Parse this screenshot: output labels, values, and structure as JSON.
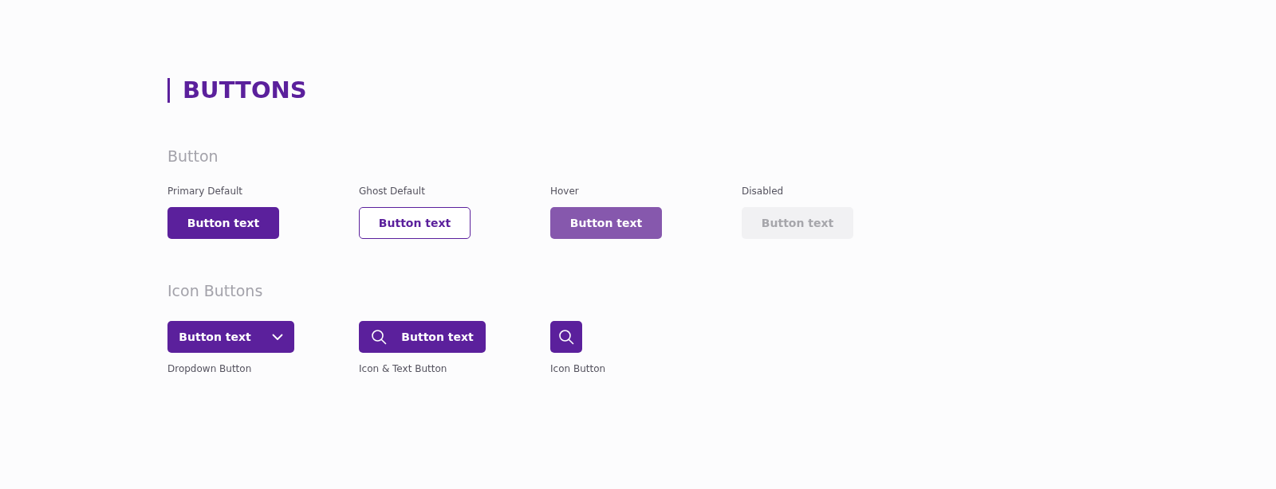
{
  "title": "BUTTONS",
  "sections": [
    {
      "heading": "Button",
      "variants": [
        {
          "label": "Primary Default",
          "kind": "primary",
          "text": "Button text",
          "disabled": false
        },
        {
          "label": "Ghost Default",
          "kind": "ghost",
          "text": "Button text",
          "disabled": false
        },
        {
          "label": "Hover",
          "kind": "hover",
          "text": "Button text",
          "disabled": false
        },
        {
          "label": "Disabled",
          "kind": "primary",
          "text": "Button text",
          "disabled": true
        }
      ]
    },
    {
      "heading": "Icon Buttons",
      "variants": [
        {
          "label": "Dropdown Button",
          "kind": "dropdown",
          "text": "Button text",
          "disabled": false
        },
        {
          "label": "Icon & Text Button",
          "kind": "icon_text",
          "text": "Button text",
          "disabled": false
        },
        {
          "label": "Icon Button",
          "kind": "icon",
          "disabled": false
        }
      ]
    }
  ]
}
